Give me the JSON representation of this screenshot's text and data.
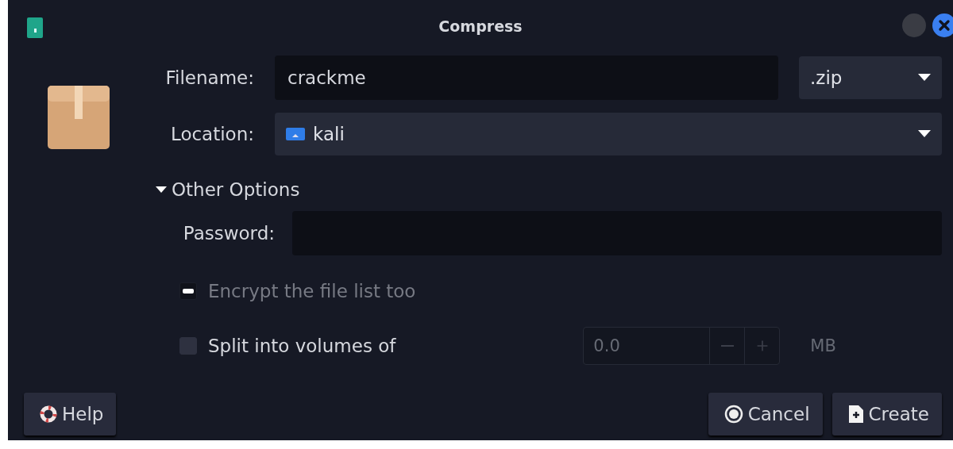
{
  "window": {
    "title": "Compress"
  },
  "filename": {
    "label": "Filename:",
    "value": "crackme",
    "extension": ".zip"
  },
  "location": {
    "label": "Location:",
    "value": "kali"
  },
  "other_options": {
    "label": "Other Options",
    "expanded": true,
    "password": {
      "label": "Password:"
    },
    "checkboxes": [
      {
        "label": "Encrypt the file list too",
        "checked": true,
        "disabled": true
      },
      {
        "label": "Split into volumes of",
        "checked": false,
        "disabled": false
      }
    ],
    "volume": {
      "value": "0.0",
      "unit": "MB",
      "disabled": true
    }
  },
  "buttons": [
    {
      "label": "Help",
      "kind": "help"
    },
    {
      "label": "Cancel",
      "kind": "cancel"
    },
    {
      "label": "Create",
      "kind": "create"
    }
  ]
}
